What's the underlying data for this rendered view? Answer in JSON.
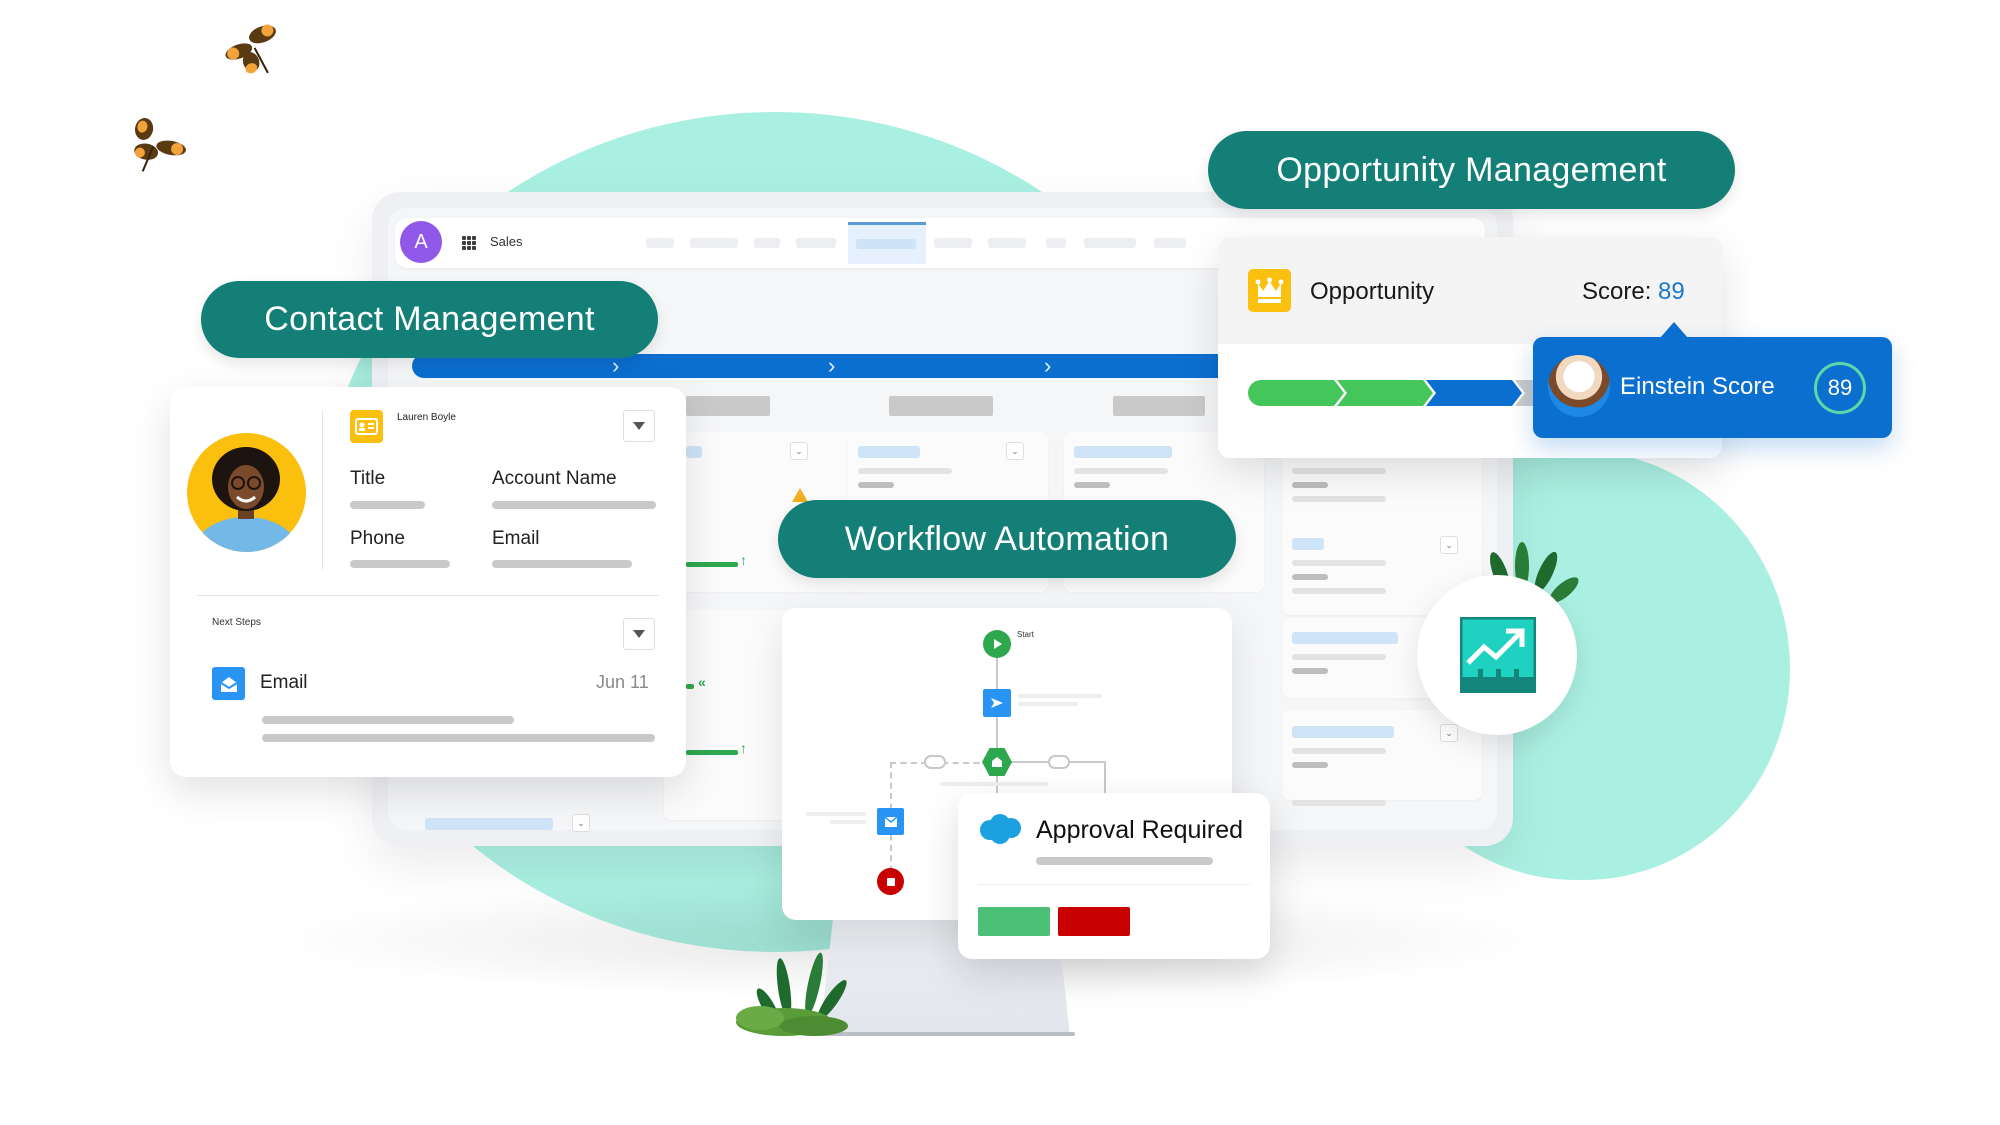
{
  "app": {
    "avatar_initial": "A",
    "app_name": "Sales"
  },
  "labels": {
    "contact_management": "Contact Management",
    "opportunity_management": "Opportunity Management",
    "workflow_automation": "Workflow Automation"
  },
  "contact_card": {
    "name": "Lauren Boyle",
    "fields": [
      {
        "label": "Title"
      },
      {
        "label": "Account Name"
      },
      {
        "label": "Phone"
      },
      {
        "label": "Email"
      }
    ],
    "next_steps": {
      "heading": "Next Steps",
      "item_label": "Email",
      "item_date": "Jun 11"
    }
  },
  "opportunity": {
    "title": "Opportunity",
    "score_label": "Score:",
    "score_value": "89",
    "stages": [
      {
        "status": "complete",
        "color": "#45c65a"
      },
      {
        "status": "complete",
        "color": "#45c65a"
      },
      {
        "status": "current",
        "color": "#0b6fd0"
      },
      {
        "status": "upcoming",
        "color": "#c9c9c9"
      }
    ]
  },
  "einstein": {
    "label": "Einstein Score",
    "score": "89"
  },
  "workflow": {
    "start_label": "Start",
    "nodes": [
      "start",
      "send-action",
      "decision",
      "email-action",
      "stop"
    ]
  },
  "approval": {
    "title": "Approval Required",
    "approve_color": "#4bc076",
    "reject_color": "#c80000"
  },
  "colors": {
    "teal_pill": "#137f76",
    "mint_background": "#aaf0e2",
    "brand_blue": "#0b6fd0",
    "avatar_purple": "#8f58e8",
    "accent_yellow": "#fbbf0e"
  }
}
